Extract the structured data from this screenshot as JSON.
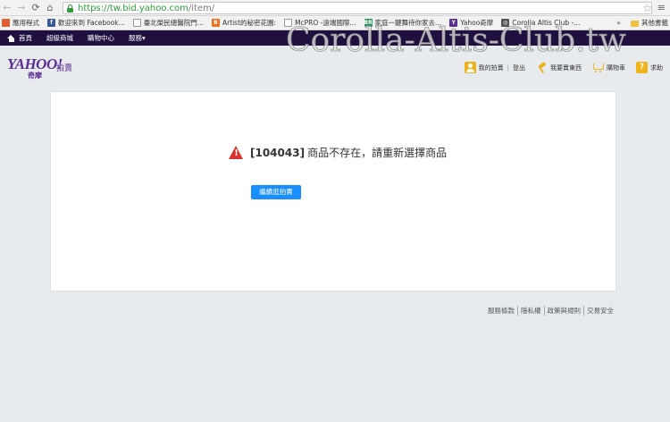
{
  "browser": {
    "url_host": "https://tw.bid.yahoo.com",
    "url_path": "/item/",
    "bookmarks": [
      {
        "label": "應用程式",
        "color": "#e06030",
        "glyph": "⋮⋮"
      },
      {
        "label": "歡迎來到 Facebook...",
        "color": "#3b5998",
        "glyph": "f"
      },
      {
        "label": "臺北榮民總醫院門...",
        "color": "#888888",
        "glyph": ""
      },
      {
        "label": "Artist的秘密花園:",
        "color": "#f07020",
        "glyph": "B"
      },
      {
        "label": "McPRO -遠端國際...",
        "color": "#888888",
        "glyph": ""
      },
      {
        "label": "家庭一鍵舞待你家去...",
        "color": "#2a9a5a",
        "glyph": "BR"
      },
      {
        "label": "Yahoo奇摩",
        "color": "#5b2d91",
        "glyph": "Y"
      },
      {
        "label": "Corolla Altis Club -...",
        "color": "#555555",
        "glyph": "◎"
      }
    ],
    "bookmarks_more": "»",
    "other_bookmarks": "其他書籤"
  },
  "watermark": "Corolla-Altis-Club.tw",
  "yahoo_nav": {
    "items": [
      "首頁",
      "超級商城",
      "購物中心",
      "服務▾"
    ]
  },
  "logo": {
    "wordmark": "YAHOO!",
    "sub_brand": "奇摩",
    "section": "拍賣"
  },
  "toplinks": {
    "my_auction": "我的拍賣",
    "logout": "登出",
    "sell": "我要賣東西",
    "cart": "購物車",
    "help": "求助"
  },
  "error": {
    "code": "[104043]",
    "message": "商品不存在，請重新選擇商品",
    "button": "繼續逛拍賣"
  },
  "footer": {
    "links": [
      "服務條款",
      "隱私權",
      "政策與規則",
      "交易安全"
    ]
  },
  "colors": {
    "nav_bg": "#1f1040",
    "brand_purple": "#5b2d91",
    "accent_yellow": "#f0b21a",
    "error_red": "#d9312b",
    "button_blue": "#188fff"
  }
}
